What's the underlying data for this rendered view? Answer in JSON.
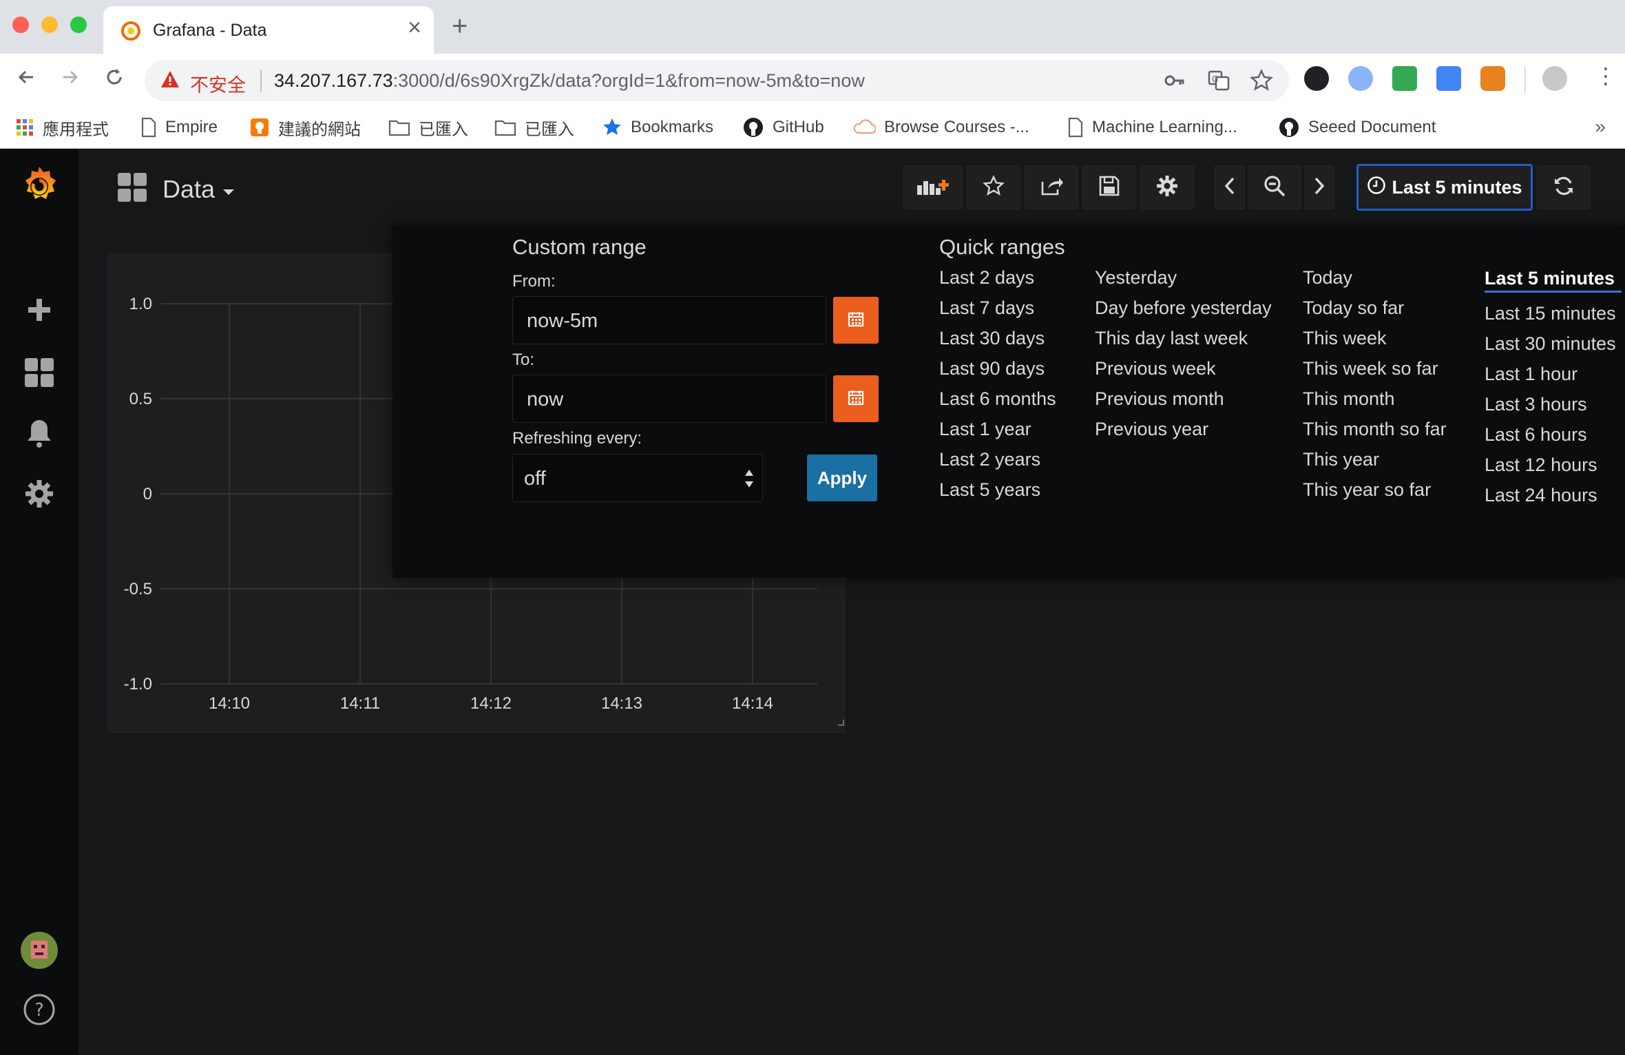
{
  "browser": {
    "tab_title": "Grafana - Data",
    "tab_close": "×",
    "new_tab": "+",
    "security_label": "不安全",
    "url_host": "34.207.167.73",
    "url_rest": ":3000/d/6s90XrgZk/data?orgId=1&from=now-5m&to=now",
    "bookmarks": [
      {
        "label": "應用程式",
        "icon": "apps-grid-icon"
      },
      {
        "label": "Empire",
        "icon": "page-icon"
      },
      {
        "label": "建議的網站",
        "icon": "lightbulb-icon"
      },
      {
        "label": "已匯入",
        "icon": "folder-icon"
      },
      {
        "label": "已匯入",
        "icon": "folder-icon"
      },
      {
        "label": "Bookmarks",
        "icon": "star-icon"
      },
      {
        "label": "GitHub",
        "icon": "github-icon"
      },
      {
        "label": "Browse Courses -...",
        "icon": "cloud-icon"
      },
      {
        "label": "Machine Learning...",
        "icon": "page-icon"
      },
      {
        "label": "Seeed Document",
        "icon": "github-icon"
      }
    ],
    "bookmarks_more": "»"
  },
  "dashboard": {
    "title": "Data",
    "time_range_button": "Last 5 minutes"
  },
  "chart_data": {
    "type": "line",
    "title": "",
    "x": [
      "14:10",
      "14:11",
      "14:12",
      "14:13",
      "14:14"
    ],
    "yticks": [
      "1.0",
      "0.5",
      "0",
      "-0.5",
      "-1.0"
    ],
    "ylim": [
      -1.0,
      1.0
    ],
    "series": [],
    "grid": true
  },
  "time_picker": {
    "custom_range_title": "Custom range",
    "from_label": "From:",
    "from_value": "now-5m",
    "to_label": "To:",
    "to_value": "now",
    "refresh_label": "Refreshing every:",
    "refresh_value": "off",
    "apply_label": "Apply",
    "quick_ranges_title": "Quick ranges",
    "quick_ranges": [
      [
        "Last 2 days",
        "Last 7 days",
        "Last 30 days",
        "Last 90 days",
        "Last 6 months",
        "Last 1 year",
        "Last 2 years",
        "Last 5 years"
      ],
      [
        "Yesterday",
        "Day before yesterday",
        "This day last week",
        "Previous week",
        "Previous month",
        "Previous year"
      ],
      [
        "Today",
        "Today so far",
        "This week",
        "This week so far",
        "This month",
        "This month so far",
        "This year",
        "This year so far"
      ],
      [
        "Last 5 minutes",
        "Last 15 minutes",
        "Last 30 minutes",
        "Last 1 hour",
        "Last 3 hours",
        "Last 6 hours",
        "Last 12 hours",
        "Last 24 hours"
      ]
    ],
    "active_range": "Last 5 minutes"
  },
  "colors": {
    "accent_orange": "#eb5e1e",
    "apply_blue": "#1a6fa3",
    "active_underline": "#3d71d9"
  }
}
